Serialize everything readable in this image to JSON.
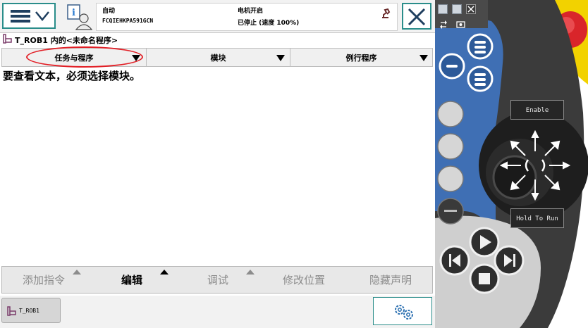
{
  "status": {
    "mode": "自动",
    "controller_id": "FCQIEHKPA591GCN",
    "motor_state": "电机开启",
    "run_state": "已停止 (速度 100%)"
  },
  "title": "T_ROB1 内的<未命名程序>",
  "tabs": [
    {
      "label": "任务与程序"
    },
    {
      "label": "模块"
    },
    {
      "label": "例行程序"
    }
  ],
  "message": "要查看文本，必须选择模块。",
  "commands": [
    {
      "label": "添加指令",
      "active": false,
      "has_menu": true
    },
    {
      "label": "编辑",
      "active": true,
      "has_menu": true
    },
    {
      "label": "调试",
      "active": false,
      "has_menu": true
    },
    {
      "label": "修改位置",
      "active": false,
      "has_menu": false
    },
    {
      "label": "隐藏声明",
      "active": false,
      "has_menu": false
    }
  ],
  "taskbar": {
    "task_label": "T_ROB1"
  },
  "pendant": {
    "enable_label": "Enable",
    "hold_to_run_label": "Hold To Run"
  },
  "colors": {
    "accent": "#2a8d8a",
    "highlight": "#e21f26",
    "pendant_blue": "#3f6fb4",
    "emergency_red": "#d9252a",
    "yellow": "#f2d200"
  }
}
